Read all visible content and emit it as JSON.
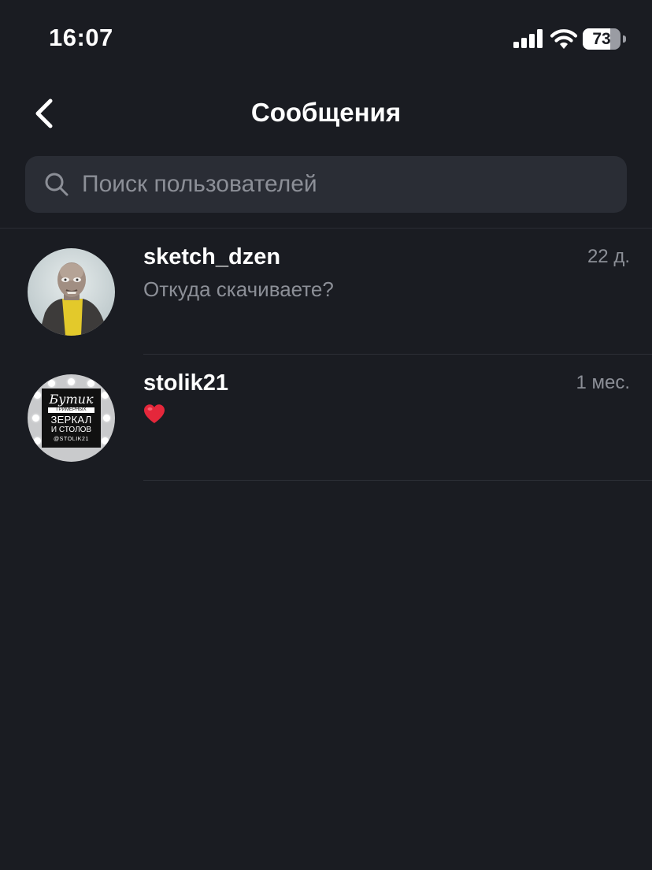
{
  "status_bar": {
    "time": "16:07",
    "battery_level": "73",
    "battery_fraction": 0.73,
    "icons": [
      "signal-icon",
      "wifi-icon",
      "battery-icon"
    ]
  },
  "header": {
    "title": "Сообщения",
    "back_icon": "chevron-left-icon"
  },
  "search": {
    "placeholder": "Поиск пользователей",
    "value": "",
    "icon": "search-icon"
  },
  "conversations": [
    {
      "username": "sketch_dzen",
      "preview": "Откуда скачиваете?",
      "time": "22 д.",
      "avatar": "illustrated-portrait-avatar"
    },
    {
      "username": "stolik21",
      "preview": "❤️",
      "time": "1 мес.",
      "avatar": "logo-avatar",
      "avatar_text": [
        "Бутик",
        "ГРИМЁРНЫХ",
        "ЗЕРКАЛ",
        "И СТОЛОВ",
        "@STOLIK21"
      ]
    }
  ],
  "colors": {
    "background": "#1a1c22",
    "search_background": "#2a2d35",
    "secondary_text": "#8c8f97",
    "primary_text": "#ffffff",
    "heart": "#e5273b"
  }
}
